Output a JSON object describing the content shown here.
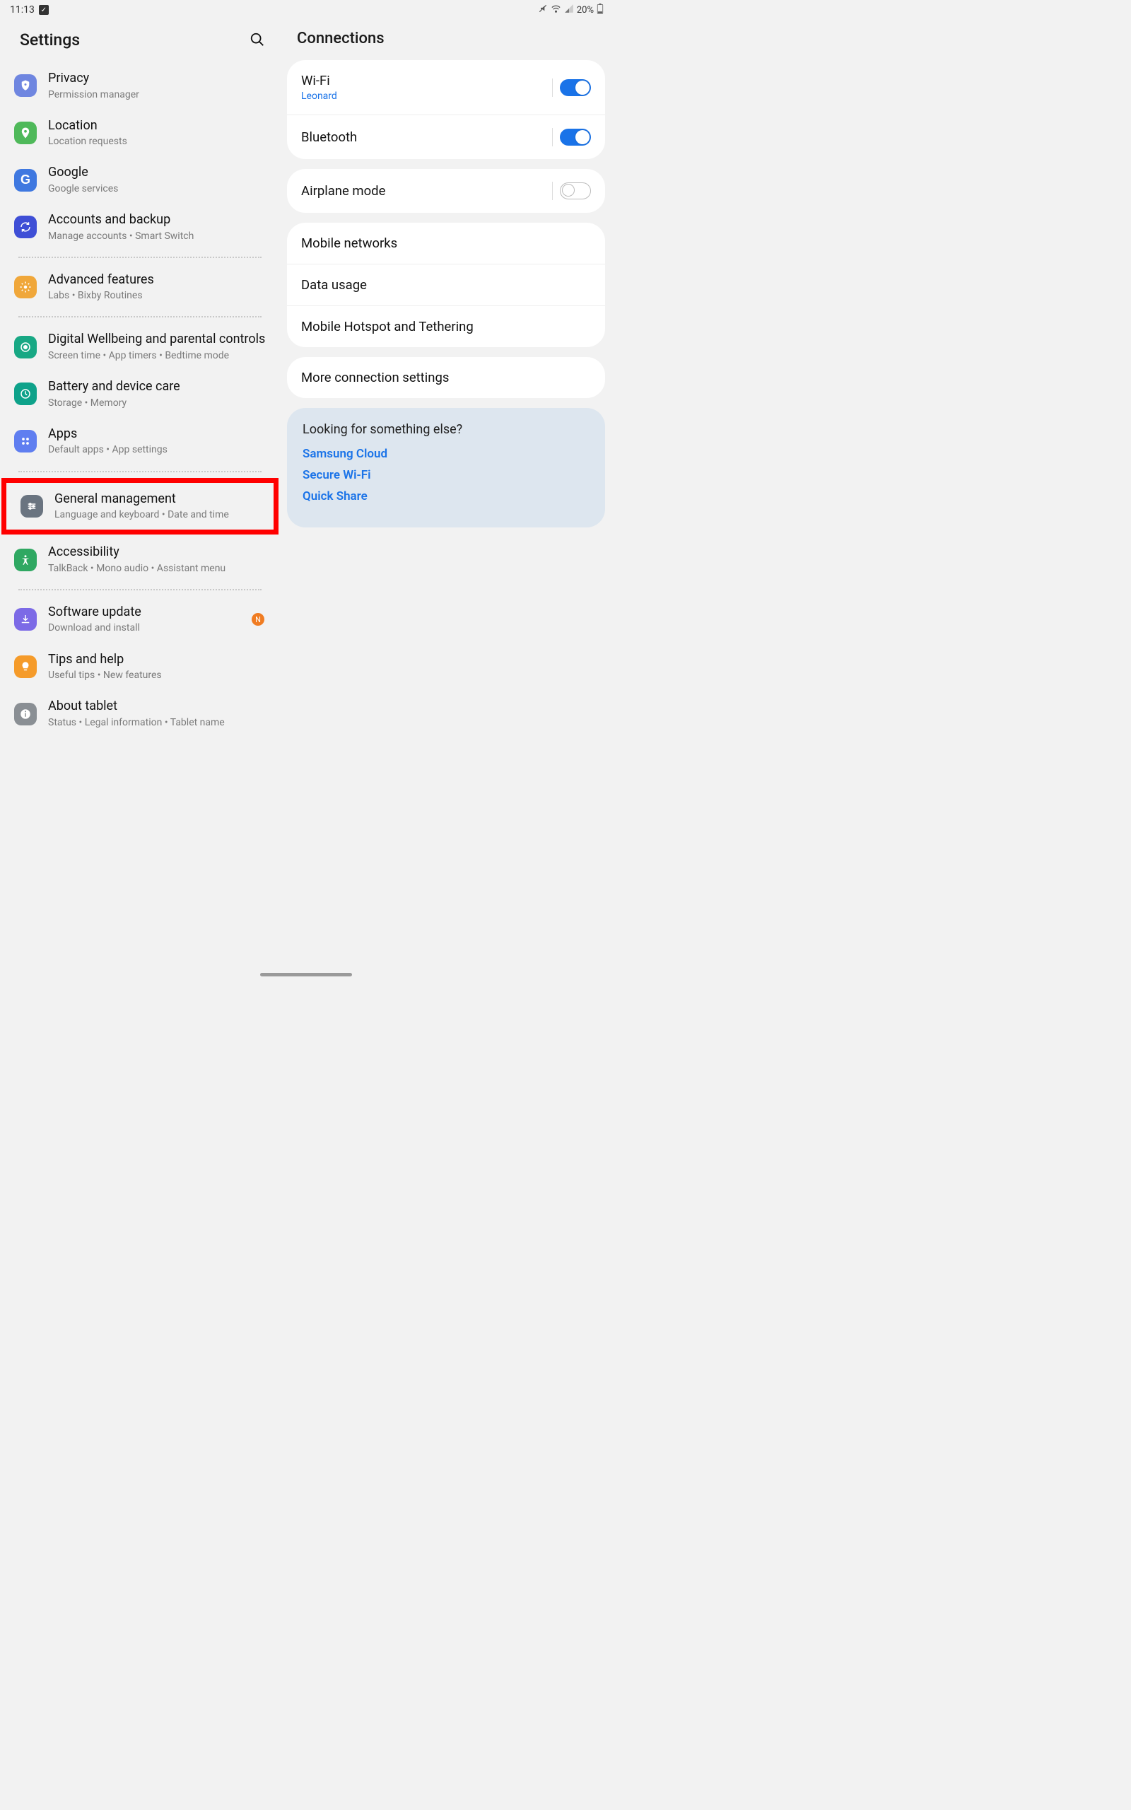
{
  "status": {
    "time": "11:13",
    "battery": "20%"
  },
  "leftTitle": "Settings",
  "rightTitle": "Connections",
  "settings": {
    "privacy": {
      "title": "Privacy",
      "sub": "Permission manager"
    },
    "location": {
      "title": "Location",
      "sub": "Location requests"
    },
    "google": {
      "title": "Google",
      "sub": "Google services"
    },
    "accounts": {
      "title": "Accounts and backup",
      "sub": "Manage accounts  •  Smart Switch"
    },
    "advanced": {
      "title": "Advanced features",
      "sub": "Labs  •  Bixby Routines"
    },
    "wellbeing": {
      "title": "Digital Wellbeing and parental controls",
      "sub": "Screen time  •  App timers  •  Bedtime mode"
    },
    "battery": {
      "title": "Battery and device care",
      "sub": "Storage  •  Memory"
    },
    "apps": {
      "title": "Apps",
      "sub": "Default apps  •  App settings"
    },
    "general": {
      "title": "General management",
      "sub": "Language and keyboard  •  Date and time"
    },
    "accessibility": {
      "title": "Accessibility",
      "sub": "TalkBack  •  Mono audio  •  Assistant menu"
    },
    "software": {
      "title": "Software update",
      "sub": "Download and install",
      "badge": "N"
    },
    "tips": {
      "title": "Tips and help",
      "sub": "Useful tips  •  New features"
    },
    "about": {
      "title": "About tablet",
      "sub": "Status  •  Legal information  •  Tablet name"
    }
  },
  "connections": {
    "wifi": {
      "label": "Wi-Fi",
      "sub": "Leonard",
      "on": true
    },
    "bluetooth": {
      "label": "Bluetooth",
      "on": true
    },
    "airplane": {
      "label": "Airplane mode",
      "on": false
    },
    "mobile": {
      "label": "Mobile networks"
    },
    "datausage": {
      "label": "Data usage"
    },
    "hotspot": {
      "label": "Mobile Hotspot and Tethering"
    },
    "more": {
      "label": "More connection settings"
    }
  },
  "footer": {
    "title": "Looking for something else?",
    "links": [
      "Samsung Cloud",
      "Secure Wi-Fi",
      "Quick Share"
    ]
  }
}
